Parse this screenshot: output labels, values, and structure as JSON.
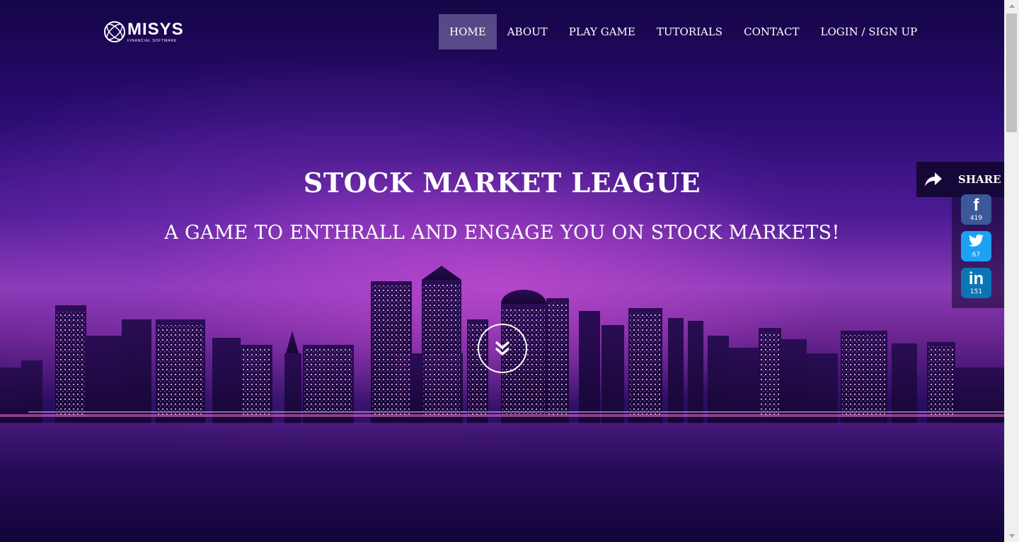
{
  "brand": {
    "name": "MISYS",
    "tagline": "FINANCIAL SOFTWARE",
    "logo_icon": "misys-globe-logo"
  },
  "nav": {
    "items": [
      {
        "label": "HOME",
        "active": true
      },
      {
        "label": "ABOUT",
        "active": false
      },
      {
        "label": "PLAY GAME",
        "active": false
      },
      {
        "label": "TUTORIALS",
        "active": false
      },
      {
        "label": "CONTACT",
        "active": false
      },
      {
        "label": "LOGIN / SIGN UP",
        "active": false
      }
    ]
  },
  "hero": {
    "title": "STOCK MARKET LEAGUE",
    "subtitle": "A GAME TO ENTHRALL AND ENGAGE YOU ON STOCK MARKETS!",
    "scroll_icon": "double-chevron-down-icon",
    "background": "city skyline at night"
  },
  "share": {
    "label": "SHARE",
    "icon": "share-arrow-icon",
    "buttons": [
      {
        "network": "facebook",
        "glyph": "f",
        "count": "419",
        "color": "#3b5998",
        "icon": "facebook-icon"
      },
      {
        "network": "twitter",
        "glyph": "",
        "count": "67",
        "color": "#1da1f2",
        "icon": "twitter-bird-icon"
      },
      {
        "network": "linkedin",
        "glyph": "in",
        "count": "151",
        "color": "#0a75b5",
        "icon": "linkedin-icon"
      }
    ]
  },
  "colors": {
    "nav_active_bg": "#6c5e9a",
    "hero_sky_top": "#150546",
    "hero_glow": "#d650d6",
    "water": "#12043a"
  }
}
